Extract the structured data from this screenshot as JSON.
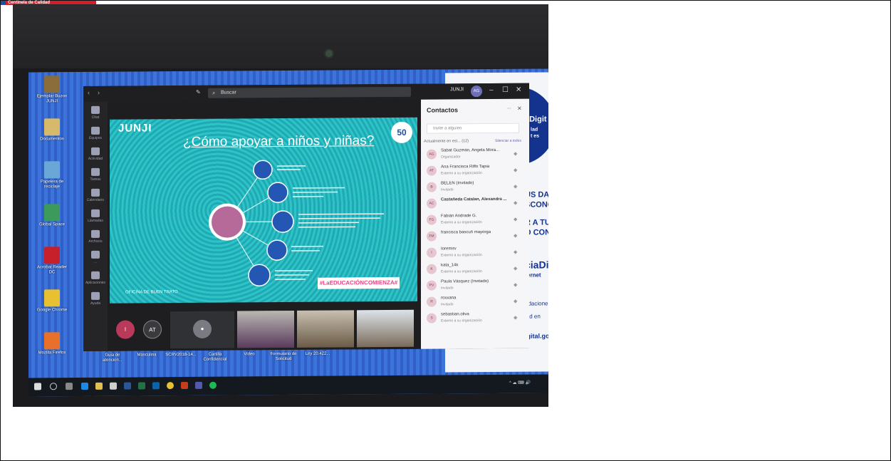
{
  "doc_badge": "Centinela de Calidad",
  "desktop": {
    "icons": [
      {
        "label": "Ejemplar Buzon JUNJI",
        "color": "#8a6d3b"
      },
      {
        "label": "Documentos",
        "color": "#d6b96a"
      },
      {
        "label": "Papelera de reciclaje",
        "color": "#6aa7d6"
      },
      {
        "label": "Global Space",
        "color": "#3c9a5d"
      },
      {
        "label": "Acrobat Reader DC",
        "color": "#c8202a"
      },
      {
        "label": "Google Chrome",
        "color": "#e8c030"
      },
      {
        "label": "Mozilla Firefox",
        "color": "#e8702a"
      }
    ],
    "bottom_labels": [
      "Guia de atencion...",
      "Masculina",
      "SCRV2018-14...",
      "Cartilla Confidencial",
      "Video",
      "Formulario de Solicitud",
      "Ley 20.422..."
    ],
    "right_panel": {
      "lines": [
        "aDigit",
        "lad",
        "t es",
        "US DAT",
        "SCONO",
        "R A TU",
        "O CONC",
        "ciaDi",
        "ernet",
        "ndacione",
        "lad en",
        "igital.go"
      ]
    }
  },
  "teams": {
    "search_placeholder": "Buscar",
    "user_name": "JUNJI",
    "user_initials": "AG",
    "window_buttons": [
      "–",
      "☐",
      "✕"
    ],
    "rail": [
      "Chat",
      "Equipos",
      "Actividad",
      "Tareas",
      "Calendario",
      "Llamadas",
      "Archivos",
      "...",
      "Aplicaciones",
      "Ayuda"
    ],
    "slide": {
      "logo": "JUNJI",
      "title": "¿Cómo apoyar a niños y niñas?",
      "anniversary": "50",
      "footer": "OFICINA DE BUEN TRATO",
      "badge": "#LaEDUCACIÓNCOMIENZA#"
    },
    "tiles": [
      {
        "initials": "I",
        "color": "#b8395a"
      },
      {
        "initials": "AT",
        "color": "#3a3a3e"
      }
    ]
  },
  "contacts": {
    "title": "Contactos",
    "more": "···",
    "close": "✕",
    "invite_placeholder": "Invite a alguien",
    "section": "Actualmente en est... (12)",
    "mute_all": "Silenciar a todos",
    "people": [
      {
        "initials": "AG",
        "name": "Sabat Guzmán, Angela Mora...",
        "sub": "Organizador",
        "bold": false
      },
      {
        "initials": "AT",
        "name": "Ana Francisca Riffo Tapia",
        "sub": "Externo a su organización",
        "bold": false
      },
      {
        "initials": "B",
        "name": "BELEN (Invitado)",
        "sub": "Invitado",
        "bold": false
      },
      {
        "initials": "AC",
        "name": "Castañeda Catalan, Alexandra ...",
        "sub": "",
        "bold": true
      },
      {
        "initials": "FG",
        "name": "Fabián Andrade G.",
        "sub": "Externo a su organización",
        "bold": false
      },
      {
        "initials": "FM",
        "name": "francisca bascuñ mayorga",
        "sub": "",
        "bold": false
      },
      {
        "initials": "I",
        "name": "Ioremirv",
        "sub": "Externo a su organización",
        "bold": false
      },
      {
        "initials": "K",
        "name": "kata_14k",
        "sub": "Externo a su organización",
        "bold": false
      },
      {
        "initials": "PV",
        "name": "Paula Vásquez (Invitado)",
        "sub": "Invitado",
        "bold": false
      },
      {
        "initials": "R",
        "name": "roxxana",
        "sub": "Invitado",
        "bold": false
      },
      {
        "initials": "S",
        "name": "sebastian.oliva",
        "sub": "Externo a su organización",
        "bold": false
      }
    ]
  },
  "taskbar": {
    "tray": "^ ☁ ⌨ 🔊"
  }
}
